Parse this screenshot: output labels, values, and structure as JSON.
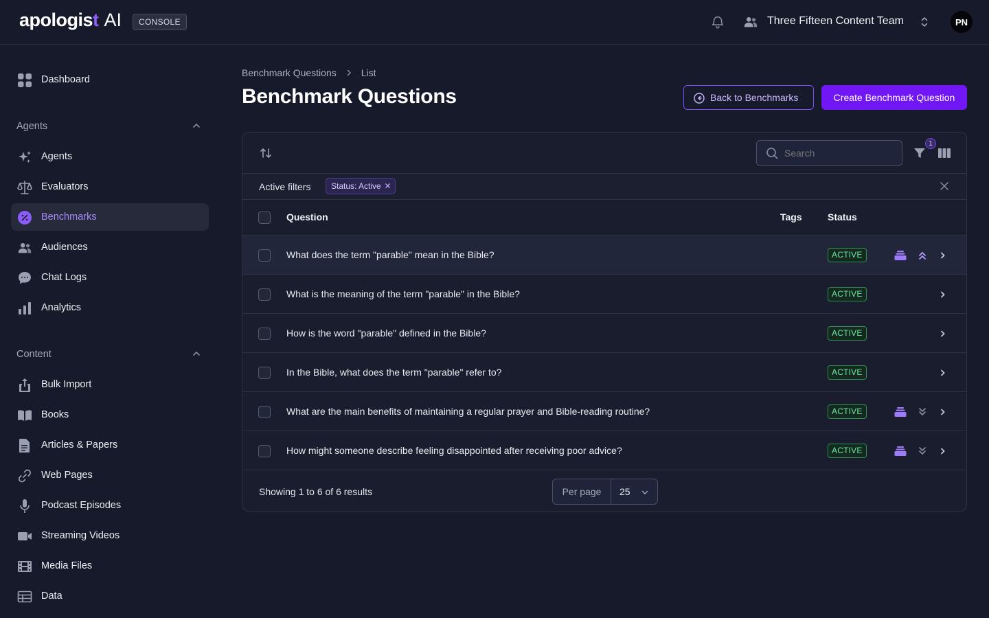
{
  "app": {
    "logo_main": "apologis",
    "logo_t": "t",
    "logo_ai": "AI",
    "console_badge": "CONSOLE"
  },
  "topbar": {
    "team_name": "Three Fifteen Content Team",
    "avatar_initials": "PN"
  },
  "sidebar": {
    "dashboard": "Dashboard",
    "groups": [
      {
        "label": "Agents",
        "items": [
          "Agents",
          "Evaluators",
          "Benchmarks",
          "Audiences",
          "Chat Logs",
          "Analytics"
        ]
      },
      {
        "label": "Content",
        "items": [
          "Bulk Import",
          "Books",
          "Articles & Papers",
          "Web Pages",
          "Podcast Episodes",
          "Streaming Videos",
          "Media Files",
          "Data"
        ]
      }
    ],
    "active_item": "Benchmarks",
    "active_color": "#a78bfa"
  },
  "breadcrumb": {
    "parent": "Benchmark Questions",
    "current": "List"
  },
  "page": {
    "title": "Benchmark Questions",
    "back_button": "Back to Benchmarks",
    "create_button": "Create Benchmark Question",
    "accent_color": "#7117f5"
  },
  "table": {
    "search_placeholder": "Search",
    "filter_count": "1",
    "active_filters_label": "Active filters",
    "filter_chip": "Status: Active",
    "columns": {
      "question": "Question",
      "tags": "Tags",
      "status": "Status"
    },
    "rows": [
      {
        "question": "What does the term \"parable\" mean in the Bible?",
        "status": "ACTIVE",
        "has_stack": true,
        "priority": "up"
      },
      {
        "question": "What is the meaning of the term \"parable\" in the Bible?",
        "status": "ACTIVE",
        "has_stack": false,
        "priority": ""
      },
      {
        "question": "How is the word \"parable\" defined in the Bible?",
        "status": "ACTIVE",
        "has_stack": false,
        "priority": ""
      },
      {
        "question": "In the Bible, what does the term \"parable\" refer to?",
        "status": "ACTIVE",
        "has_stack": false,
        "priority": ""
      },
      {
        "question": "What are the main benefits of maintaining a regular prayer and Bible-reading routine?",
        "status": "ACTIVE",
        "has_stack": true,
        "priority": "down"
      },
      {
        "question": "How might someone describe feeling disappointed after receiving poor advice?",
        "status": "ACTIVE",
        "has_stack": true,
        "priority": "down"
      }
    ],
    "results_text": "Showing 1 to 6 of 6 results",
    "per_page_label": "Per page",
    "per_page_value": "25",
    "status_color": "#6ee7a0"
  }
}
